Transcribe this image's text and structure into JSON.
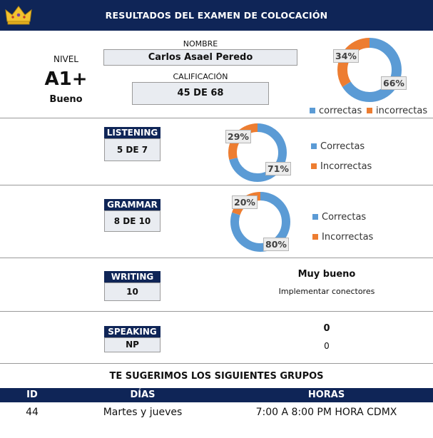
{
  "header": {
    "title": "RESULTADOS DEL EXAMEN DE COLOCACIÓN"
  },
  "summary": {
    "level_label": "NIVEL",
    "level_value": "A1+",
    "level_desc": "Bueno",
    "name_label": "NOMBRE",
    "name_value": "Carlos Asael Peredo",
    "score_label": "CALIFICACIÓN",
    "score_value": "45 DE 68"
  },
  "colors": {
    "correct": "#5b9bd5",
    "incorrect": "#ed7d31",
    "navy": "#0f2557"
  },
  "overall_legend": {
    "correct": "correctas",
    "incorrect": "incorrectas"
  },
  "sections": {
    "listening": {
      "label": "LISTENING",
      "score": "5 DE 7"
    },
    "grammar": {
      "label": "GRAMMAR",
      "score": "8 DE 10"
    },
    "writing": {
      "label": "WRITING",
      "score": "10",
      "rating": "Muy bueno",
      "comment": "Implementar conectores"
    },
    "speaking": {
      "label": "SPEAKING",
      "score": "NP",
      "rating": "0",
      "comment": "0"
    }
  },
  "section_legend": {
    "correct": "Correctas",
    "incorrect": "Incorrectas"
  },
  "chart_data": [
    {
      "type": "pie",
      "categories": [
        "correctas",
        "incorrectas"
      ],
      "values": [
        66,
        34
      ],
      "labels": [
        "66%",
        "34%"
      ],
      "legend": "bottom"
    },
    {
      "type": "pie",
      "categories": [
        "Correctas",
        "Incorrectas"
      ],
      "values": [
        71,
        29
      ],
      "labels": [
        "71%",
        "29%"
      ],
      "legend": "right"
    },
    {
      "type": "pie",
      "categories": [
        "Correctas",
        "Incorrectas"
      ],
      "values": [
        80,
        20
      ],
      "labels": [
        "80%",
        "20%"
      ],
      "legend": "right"
    }
  ],
  "groups": {
    "title": "TE SUGERIMOS LOS SIGUIENTES GRUPOS",
    "columns": [
      "ID",
      "DÍAS",
      "HORAS"
    ],
    "rows": [
      [
        "44",
        "Martes y jueves",
        "7:00 A 8:00 PM HORA CDMX"
      ]
    ]
  }
}
